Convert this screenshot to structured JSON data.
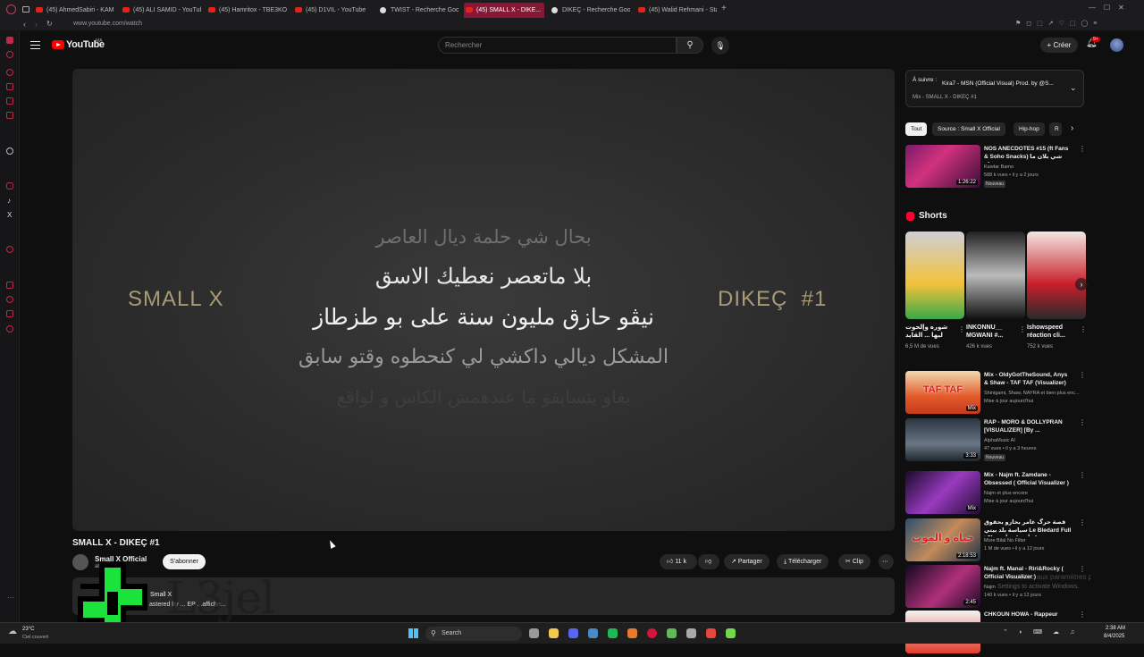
{
  "browser": {
    "tabs": [
      {
        "label": "(45) AhmedSabiri - KAM...",
        "type": "yt"
      },
      {
        "label": "(45) ALI SAMID - YouTub...",
        "type": "yt"
      },
      {
        "label": "(45) Hamritox - TBE3KO...",
        "type": "yt"
      },
      {
        "label": "(45) D1VIL - YouTube",
        "type": "yt"
      },
      {
        "label": "TWIST - Recherche Goog...",
        "type": "google"
      },
      {
        "label": "(45) SMALL X - DIKE...",
        "type": "yt",
        "active": true
      },
      {
        "label": "DIKEÇ - Recherche Goog...",
        "type": "google"
      },
      {
        "label": "(45) Walid Rehmani - Sta...",
        "type": "yt"
      }
    ],
    "url": "www.youtube.com/watch"
  },
  "header": {
    "logo_text": "YouTube",
    "logo_sup": "MA",
    "search_placeholder": "Rechercher",
    "create_label": "Créer",
    "notif_badge": "9+"
  },
  "player": {
    "left_text": "SMALL X",
    "right_text": "DIKEÇ  #1",
    "lyrics": [
      "بحال شي حلمة ديال العاصر",
      "بلا ماتعصر نعطيك الاسق",
      "نيڤو حازق مليون سنة  على بو طزطاز",
      "المشكل ديالي داكشي لي كنحطوه وقتو سابق",
      "بغاو يتسابقو ما عندهمش الكاس و لواقع"
    ]
  },
  "video": {
    "title": "SMALL X - DIKEÇ #1",
    "channel": "Small X Official",
    "subscribers": "abonnés",
    "subscribe_label": "S'abonner",
    "likes": "11 k",
    "share_label": "Partager",
    "download_label": "Télécharger",
    "clip_label": "Clip",
    "description_channel": "Small X",
    "description_line": "astered by ... EP ...affiche..."
  },
  "watermark": {
    "text": "L3jel"
  },
  "up_next": {
    "label": "À suivre :",
    "title": "Kira7 - MSN (Official Visual) Prod. by @S...",
    "subtitle": "Mix - SMALL X - DIKEÇ #1"
  },
  "chips": [
    "Tout",
    "Source : Small X Official",
    "Hip-hop",
    "R"
  ],
  "videos_top": [
    {
      "title": "NOS ANECDOTES #15 (ft Fans & Soho Snacks) شي بلان ما واو",
      "channel": "Kawtar Bamo",
      "meta": "588 k vues • il y a 2 jours",
      "badge": "Nouveau",
      "duration": "1:26:22"
    }
  ],
  "shorts": {
    "heading": "Shorts",
    "items": [
      {
        "title": "شوره وإلحوت ليها ... القايد",
        "views": "6,5 M de vues"
      },
      {
        "title": "INKONNU__ MGWANI #...",
        "views": "426 k vues"
      },
      {
        "title": "Ishowspeed réaction cli...",
        "views": "752 k vues"
      }
    ]
  },
  "videos": [
    {
      "title": "Mix - OldyGotTheSound, Anys & Shaw - TAF TAF (Visualizer)",
      "channel": "Shinigami, Shaw, NAYRA et bien plus enc...",
      "meta": "Mise à jour aujourd'hui",
      "duration": "Mix",
      "thumb_text": "TAF TAF"
    },
    {
      "title": "RAP - MORO & DOLLYPRAN [VISUALIZER] [By ...",
      "channel": "AlphaMusic AI",
      "meta": "47 vues • il y a 3 heures",
      "badge": "Nouveau",
      "duration": "3:33"
    },
    {
      "title": "Mix - Najm ft. Zamdane - Obsessed ( Official Visualizer )",
      "channel": "Najm et plus encore",
      "meta": "Mise à jour aujourd'hui",
      "duration": "Mix"
    },
    {
      "title": "قصة حرگ عامر بحارو بحقوق سياسة بلد بيتي Le Bledard Full | حياة أفضل فأوروبا؟",
      "channel": "More Bilal No Filter",
      "meta": "1 M de vues • il y a 12 jours",
      "duration": "2:18:53",
      "thumb_text": "حياة و الموت"
    },
    {
      "title": "Najm ft. Manal - Riri&Rocky ( Official Visualizer )",
      "channel": "Najm",
      "meta": "140 k vues • il y a 12 jours",
      "duration": "2:45"
    },
    {
      "title": "CHKOUN HOWA - Rappeur",
      "channel": "",
      "meta": "",
      "duration": ""
    }
  ],
  "activate_windows": "Accédez aux paramètres pour activer Windows.",
  "activate_windows_short": "Settings to activate Windows.",
  "taskbar": {
    "weather_temp": "23°C",
    "weather_desc": "Ciel couvert",
    "search_label": "Search",
    "time": "2:38 AM",
    "date": "8/4/2025"
  }
}
